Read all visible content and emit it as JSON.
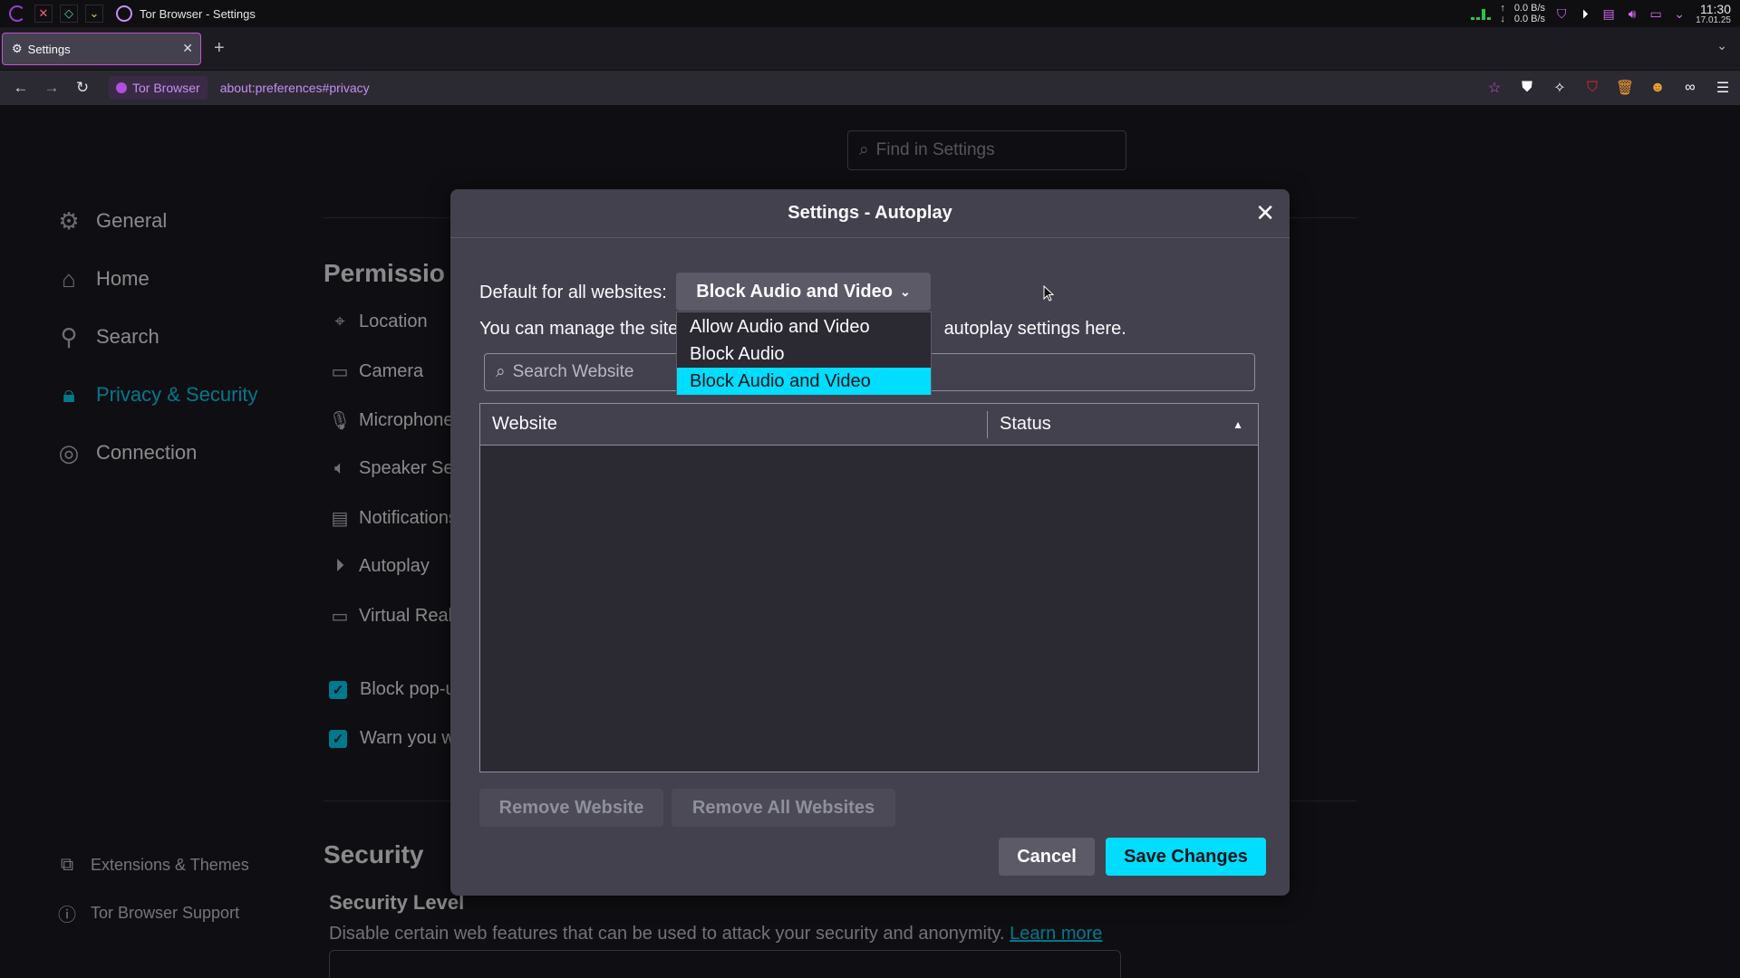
{
  "sysbar": {
    "window_title": "Tor Browser - Settings",
    "net_up": "0.0 B/s",
    "net_down": "0.0 B/s",
    "time": "11:30",
    "date": "17.01.25"
  },
  "tabs": {
    "active_label": "Settings"
  },
  "navbar": {
    "identity_label": "Tor Browser",
    "url": "about:preferences#privacy"
  },
  "prefs": {
    "find_placeholder": "Find in Settings",
    "sidebar": [
      {
        "label": "General",
        "icon": "gear-icon"
      },
      {
        "label": "Home",
        "icon": "home-icon"
      },
      {
        "label": "Search",
        "icon": "search-icon"
      },
      {
        "label": "Privacy & Security",
        "icon": "lock-icon"
      },
      {
        "label": "Connection",
        "icon": "connection-icon"
      }
    ],
    "sidebar_footer": [
      {
        "label": "Extensions & Themes",
        "icon": "puzzle-icon"
      },
      {
        "label": "Tor Browser Support",
        "icon": "help-icon"
      }
    ],
    "permissions_title": "Permissio",
    "permissions": [
      {
        "label": "Location",
        "icon": "location-icon"
      },
      {
        "label": "Camera",
        "icon": "camera-icon"
      },
      {
        "label": "Microphone",
        "icon": "microphone-icon"
      },
      {
        "label": "Speaker Se",
        "icon": "speaker-icon"
      },
      {
        "label": "Notifications",
        "icon": "notification-icon"
      },
      {
        "label": "Autoplay",
        "icon": "autoplay-icon"
      },
      {
        "label": "Virtual Real",
        "icon": "vr-icon"
      }
    ],
    "checks": [
      {
        "label": "Block pop-u",
        "checked": true
      },
      {
        "label": "Warn you w",
        "checked": true
      }
    ],
    "security_title": "Security",
    "security_level_title": "Security Level",
    "security_desc": "Disable certain web features that can be used to attack your security and anonymity.",
    "learn_more": "Learn more"
  },
  "dialog": {
    "title": "Settings - Autoplay",
    "default_label": "Default for all websites:",
    "default_value": "Block Audio and Video",
    "manage_text_left": "You can manage the site",
    "manage_text_right": "autoplay settings here.",
    "search_placeholder": "Search Website",
    "col_website": "Website",
    "col_status": "Status",
    "remove_website": "Remove Website",
    "remove_all": "Remove All Websites",
    "cancel": "Cancel",
    "save": "Save Changes",
    "options": [
      "Allow Audio and Video",
      "Block Audio",
      "Block Audio and Video"
    ],
    "selected_option": "Block Audio and Video"
  },
  "colors": {
    "accent": "#00ddff",
    "tor_purple": "#c58ff2"
  }
}
